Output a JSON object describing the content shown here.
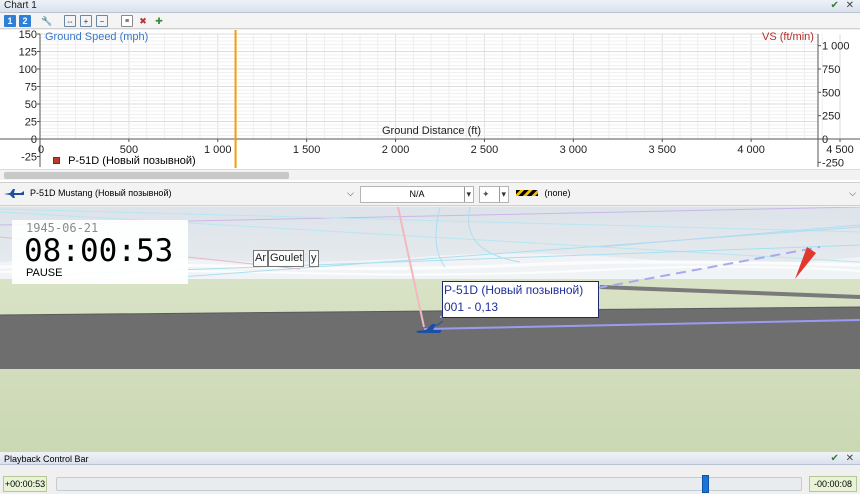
{
  "chart_panel": {
    "title": "Chart 1",
    "pin_icon": "pin-icon",
    "close_icon": "close-icon",
    "toolbar_icons": [
      "series-1-icon",
      "series-2-icon",
      "wrench-icon",
      "zoom-fit-icon",
      "zoom-in-icon",
      "zoom-out-icon",
      "page-icon",
      "remove-icon",
      "add-icon"
    ],
    "tab_1": "1",
    "tab_2": "2"
  },
  "chart_data": {
    "type": "line",
    "title": "",
    "xlabel": "Ground Distance (ft)",
    "ylabel_left": "Ground Speed (mph)",
    "ylabel_right": "VS (ft/min)",
    "x_ticks": [
      "0",
      "500",
      "1 000",
      "1 500",
      "2 000",
      "2 500",
      "3 000",
      "3 500",
      "4 000",
      "4 500"
    ],
    "x_tick_values": [
      0,
      500,
      1000,
      1500,
      2000,
      2500,
      3000,
      3500,
      4000,
      4500
    ],
    "xlim": [
      0,
      4500
    ],
    "y_left_ticks": [
      "150",
      "125",
      "100",
      "75",
      "50",
      "25",
      "0",
      "-25"
    ],
    "y_left_values": [
      150,
      125,
      100,
      75,
      50,
      25,
      0,
      -25
    ],
    "ylim_left": [
      -25,
      150
    ],
    "y_right_ticks": [
      "1 000",
      "750",
      "500",
      "250",
      "0",
      "-250"
    ],
    "y_right_values": [
      1000,
      750,
      500,
      250,
      0,
      -250
    ],
    "ylim_right": [
      -250,
      1125
    ],
    "cursor_x": 1100,
    "legend": [
      {
        "name": "P-51D (Новый позывной)",
        "color": "#c0392b"
      }
    ],
    "series": [
      {
        "name": "P-51D (Новый позывной)",
        "values": []
      }
    ],
    "grid": true,
    "cursor_color": "#f0a000",
    "left_axis_color": "#3a78c8",
    "right_axis_color": "#b03030"
  },
  "selectors": {
    "aircraft": "P-51D Mustang (Новый позывной)",
    "aircraft_icon": "airplane-icon",
    "center": "N/A",
    "style": "(none)",
    "style_icon": "hazard-stripe-icon",
    "mode_icon": "camera-icon"
  },
  "viewport": {
    "date": "1945-06-21",
    "time": "08:00:53",
    "state": "PAUSE",
    "aircraft_label_line1": "P-51D (Новый позывной)",
    "aircraft_label_line2": "001 - 0,13",
    "airport_labels": [
      "Ar",
      "Goulet",
      "y"
    ],
    "aircraft_icon": "aircraft-model-icon",
    "waypoint_icon": "red-arrow-icon"
  },
  "playback": {
    "title": "Playback Control Bar",
    "elapsed": "+00:00:53",
    "remaining": "-00:00:08",
    "progress": 0.87
  }
}
